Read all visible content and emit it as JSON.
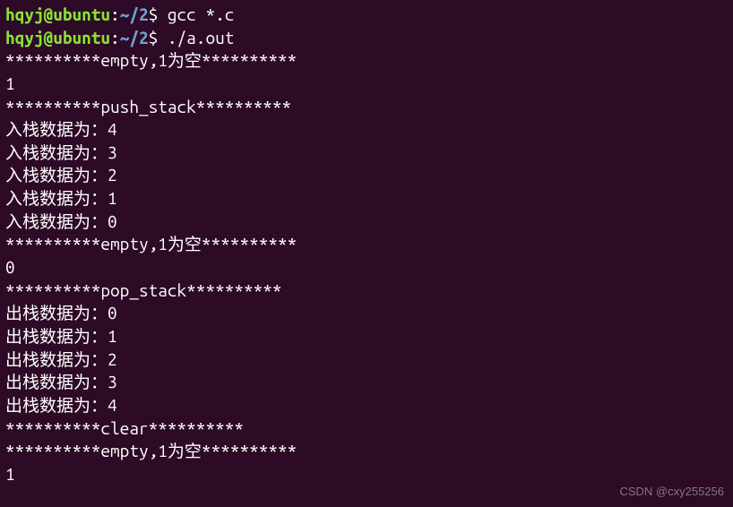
{
  "prompt": {
    "user_host": "hqyj@ubuntu",
    "colon": ":",
    "path": "~/2",
    "dollar": "$ "
  },
  "commands": [
    "gcc *.c",
    "./a.out"
  ],
  "output_lines": [
    "**********empty,1为空**********",
    "1",
    "**********push_stack**********",
    "入栈数据为：4",
    "入栈数据为：3",
    "入栈数据为：2",
    "入栈数据为：1",
    "入栈数据为：0",
    "**********empty,1为空**********",
    "0",
    "**********pop_stack**********",
    "出栈数据为：0",
    "出栈数据为：1",
    "出栈数据为：2",
    "出栈数据为：3",
    "出栈数据为：4",
    "**********clear**********",
    "**********empty,1为空**********",
    "1"
  ],
  "watermark": "CSDN @cxy255256"
}
